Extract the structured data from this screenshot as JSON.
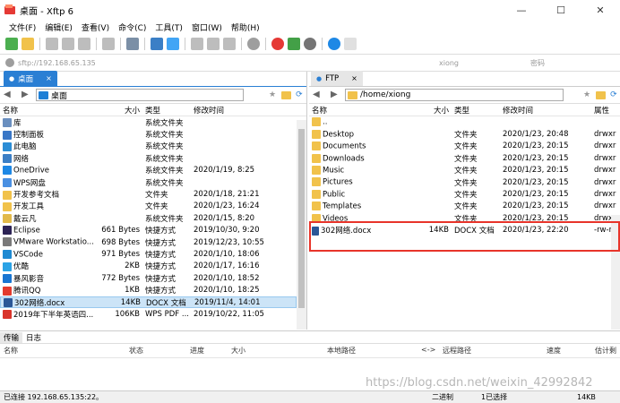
{
  "window": {
    "title": "桌面 - Xftp 6",
    "controls": [
      "—",
      "☐",
      "✕"
    ]
  },
  "menu": [
    "文件(F)",
    "编辑(E)",
    "查看(V)",
    "命令(C)",
    "工具(T)",
    "窗口(W)",
    "帮助(H)"
  ],
  "address": {
    "host_placeholder": "sftp://192.168.65.135",
    "user_placeholder": "xiong",
    "pass_placeholder": "密码"
  },
  "left": {
    "tab": "桌面",
    "path": "桌面",
    "headers": [
      "名称",
      "大小",
      "类型",
      "修改时间"
    ],
    "rows": [
      {
        "name": "库",
        "size": "",
        "type": "系统文件夹",
        "date": "",
        "icon": "#6a8fbf"
      },
      {
        "name": "控制面板",
        "size": "",
        "type": "系统文件夹",
        "date": "",
        "icon": "#3a77c6"
      },
      {
        "name": "此电脑",
        "size": "",
        "type": "系统文件夹",
        "date": "",
        "icon": "#2b8dd6"
      },
      {
        "name": "网络",
        "size": "",
        "type": "系统文件夹",
        "date": "",
        "icon": "#3b7fc6"
      },
      {
        "name": "OneDrive",
        "size": "",
        "type": "系统文件夹",
        "date": "2020/1/19, 8:25",
        "icon": "#1e88e5"
      },
      {
        "name": "WPS网盘",
        "size": "",
        "type": "系统文件夹",
        "date": "",
        "icon": "#4a90e2"
      },
      {
        "name": "开发参考文档",
        "size": "",
        "type": "文件夹",
        "date": "2020/1/18, 21:21",
        "icon": "#f1c24b"
      },
      {
        "name": "开发工具",
        "size": "",
        "type": "文件夹",
        "date": "2020/1/23, 16:24",
        "icon": "#f1c24b"
      },
      {
        "name": "戴云凡",
        "size": "",
        "type": "系统文件夹",
        "date": "2020/1/15, 8:20",
        "icon": "#e2b94a"
      },
      {
        "name": "Eclipse",
        "size": "661 Bytes",
        "type": "快捷方式",
        "date": "2019/10/30, 9:20",
        "icon": "#2c2255"
      },
      {
        "name": "VMware Workstatio...",
        "size": "698 Bytes",
        "type": "快捷方式",
        "date": "2019/12/23, 10:55",
        "icon": "#7a7a7a"
      },
      {
        "name": "VSCode",
        "size": "971 Bytes",
        "type": "快捷方式",
        "date": "2020/1/10, 18:06",
        "icon": "#1f8ad2"
      },
      {
        "name": "优酷",
        "size": "2KB",
        "type": "快捷方式",
        "date": "2020/1/17, 16:16",
        "icon": "#2ba3e6"
      },
      {
        "name": "暴风影音",
        "size": "772 Bytes",
        "type": "快捷方式",
        "date": "2020/1/10, 18:52",
        "icon": "#1875d2"
      },
      {
        "name": "腾讯QQ",
        "size": "1KB",
        "type": "快捷方式",
        "date": "2020/1/10, 18:25",
        "icon": "#e33b2e"
      },
      {
        "name": "302网络.docx",
        "size": "14KB",
        "type": "DOCX 文档",
        "date": "2019/11/4, 14:01",
        "icon": "#2b5797"
      },
      {
        "name": "2019年下半年英语四...",
        "size": "106KB",
        "type": "WPS PDF ...",
        "date": "2019/10/22, 11:05",
        "icon": "#d9352b"
      }
    ],
    "selected": 15
  },
  "right": {
    "tab": "FTP",
    "path": "/home/xiong",
    "headers": [
      "名称",
      "大小",
      "类型",
      "修改时间",
      "属性"
    ],
    "rows": [
      {
        "name": "..",
        "size": "",
        "type": "",
        "date": "",
        "attr": ""
      },
      {
        "name": "Desktop",
        "size": "",
        "type": "文件夹",
        "date": "2020/1/23, 20:48",
        "attr": "drwxr"
      },
      {
        "name": "Documents",
        "size": "",
        "type": "文件夹",
        "date": "2020/1/23, 20:15",
        "attr": "drwxr"
      },
      {
        "name": "Downloads",
        "size": "",
        "type": "文件夹",
        "date": "2020/1/23, 20:15",
        "attr": "drwxr"
      },
      {
        "name": "Music",
        "size": "",
        "type": "文件夹",
        "date": "2020/1/23, 20:15",
        "attr": "drwxr"
      },
      {
        "name": "Pictures",
        "size": "",
        "type": "文件夹",
        "date": "2020/1/23, 20:15",
        "attr": "drwxr"
      },
      {
        "name": "Public",
        "size": "",
        "type": "文件夹",
        "date": "2020/1/23, 20:15",
        "attr": "drwxr"
      },
      {
        "name": "Templates",
        "size": "",
        "type": "文件夹",
        "date": "2020/1/23, 20:15",
        "attr": "drwxr"
      },
      {
        "name": "Videos",
        "size": "",
        "type": "文件夹",
        "date": "2020/1/23, 20:15",
        "attr": "drwxr"
      },
      {
        "name": "302网络.docx",
        "size": "14KB",
        "type": "DOCX 文档",
        "date": "2020/1/23, 22:20",
        "attr": "-rw-rw"
      }
    ]
  },
  "transfer": {
    "tabs": [
      "传输",
      "日志"
    ],
    "headers": [
      "名称",
      "状态",
      "进度",
      "大小",
      "本地路径",
      "<->",
      "远程路径",
      "速度",
      "估计剩"
    ]
  },
  "status": {
    "left": "已连接 192.168.65.135:22。",
    "mode": "二进制",
    "count": "1已选择",
    "size": "14KB"
  },
  "watermark": "https://blog.csdn.net/weixin_42992842"
}
